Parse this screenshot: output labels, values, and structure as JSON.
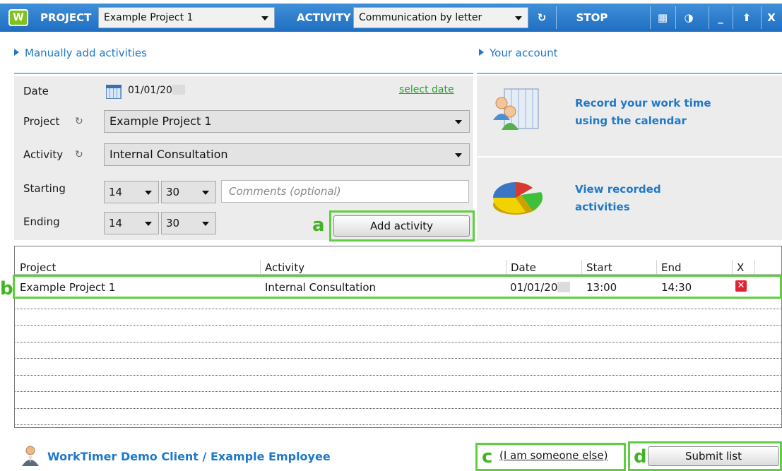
{
  "topbar": {
    "logo_text": "W",
    "project_label": "PROJECT",
    "project_selected": "Example Project 1",
    "activity_label": "ACTIVITY",
    "activity_selected": "Communication by letter",
    "stop_label": "STOP",
    "minimize_label": "_",
    "close_label": "X"
  },
  "manual": {
    "heading": "Manually add activities",
    "date_label": "Date",
    "date_value": "01/01/20",
    "select_date": "select date",
    "project_label": "Project",
    "project_value": "Example Project 1",
    "activity_label": "Activity",
    "activity_value": "Internal Consultation",
    "starting_label": "Starting",
    "start_hour": "14",
    "start_minute": "30",
    "ending_label": "Ending",
    "end_hour": "14",
    "end_minute": "30",
    "comment_placeholder": "Comments (optional)",
    "add_button": "Add activity"
  },
  "account": {
    "heading": "Your account",
    "calendar_line1": "Record your work time",
    "calendar_line2": "using the calendar",
    "view_line1": "View recorded",
    "view_line2": "activities"
  },
  "list": {
    "columns": [
      "Project",
      "Activity",
      "Date",
      "Start",
      "End",
      "X"
    ],
    "rows": [
      {
        "project": "Example Project 1",
        "activity": "Internal Consultation",
        "date": "01/01/20",
        "start": "13:00",
        "end": "14:30"
      }
    ]
  },
  "footer": {
    "user": "WorkTimer Demo Client / Example Employee",
    "someone_else": "(I am someone else)",
    "submit": "Submit list"
  },
  "annotations": {
    "a": "a",
    "b": "b",
    "c": "c",
    "d": "d"
  },
  "colors": {
    "toolbar": "#1f6ec2",
    "link": "#1f78c8",
    "highlight": "#5fcf3f",
    "panel": "#ececec"
  }
}
